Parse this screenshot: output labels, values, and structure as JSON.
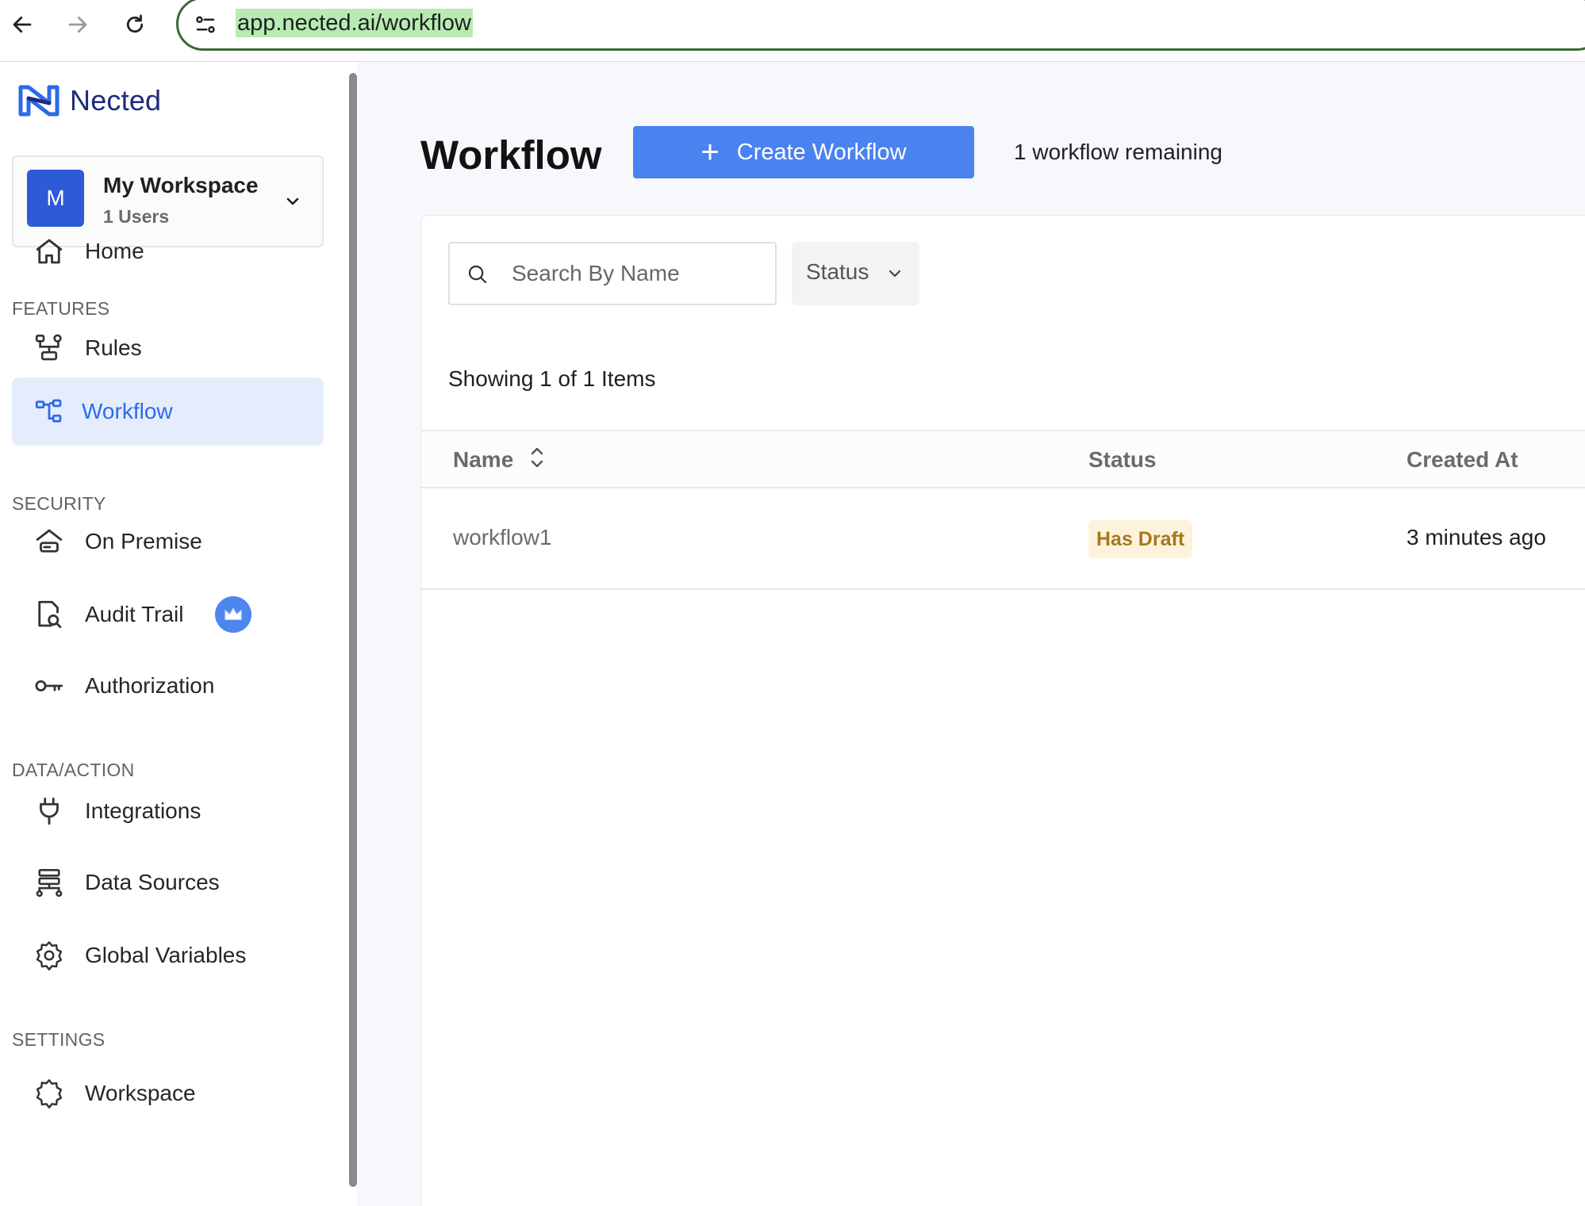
{
  "browser": {
    "url": "app.nected.ai/workflow"
  },
  "sidebar": {
    "logo_text": "Nected",
    "workspace": {
      "avatar_letter": "M",
      "name": "My Workspace",
      "users": "1 Users"
    },
    "home_label": "Home",
    "sections": {
      "features": "FEATURES",
      "security": "SECURITY",
      "data_action": "DATA/ACTION",
      "settings": "SETTINGS"
    },
    "items": {
      "rules": "Rules",
      "workflow": "Workflow",
      "on_premise": "On Premise",
      "audit_trail": "Audit Trail",
      "authorization": "Authorization",
      "integrations": "Integrations",
      "data_sources": "Data Sources",
      "global_variables": "Global Variables",
      "workspace": "Workspace"
    },
    "active_item": "workflow"
  },
  "main": {
    "title": "Workflow",
    "create_button": "Create Workflow",
    "remaining": "1 workflow remaining",
    "search_placeholder": "Search By Name",
    "status_filter": "Status",
    "showing": "Showing 1 of 1 Items",
    "table": {
      "columns": [
        "Name",
        "Status",
        "Created At"
      ],
      "rows": [
        {
          "name": "workflow1",
          "status": "Has Draft",
          "created_at": "3 minutes ago"
        }
      ]
    }
  },
  "colors": {
    "accent": "#4a82f0",
    "active_bg": "#e5edfd",
    "active_text": "#2e6be6",
    "draft_bg": "#fdf3dc",
    "draft_text": "#a8781c"
  }
}
